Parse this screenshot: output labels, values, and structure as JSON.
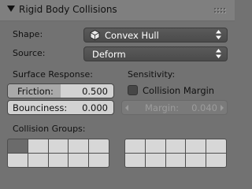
{
  "panel": {
    "title": "Rigid Body Collisions",
    "shape_label": "Shape:",
    "shape_value": "Convex Hull",
    "source_label": "Source:",
    "source_value": "Deform",
    "surface_response_label": "Surface Response:",
    "friction_label": "Friction:",
    "friction_value": "0.500",
    "friction_fraction": 0.5,
    "bounciness_label": "Bounciness:",
    "bounciness_value": "0.000",
    "sensitivity_label": "Sensitivity:",
    "collision_margin_label": "Collision Margin",
    "collision_margin_checked": false,
    "margin_label": "Margin:",
    "margin_value": "0.040",
    "collision_groups_label": "Collision Groups:",
    "groups_left_active": [
      0
    ],
    "groups_right_active": []
  },
  "icons": {
    "collapse": "disclosure-triangle-icon",
    "grip": "drag-grip-icon",
    "shape": "convex-hull-icon",
    "dropdown_arrows": "up-down-arrows-icon"
  },
  "colors": {
    "panel_bg": "#727272",
    "header_bg": "#7f7f7f",
    "dropdown_bg": "#4b4b4b",
    "field_bg": "#d2d2d2",
    "field_fill": "#a9a9a9"
  }
}
